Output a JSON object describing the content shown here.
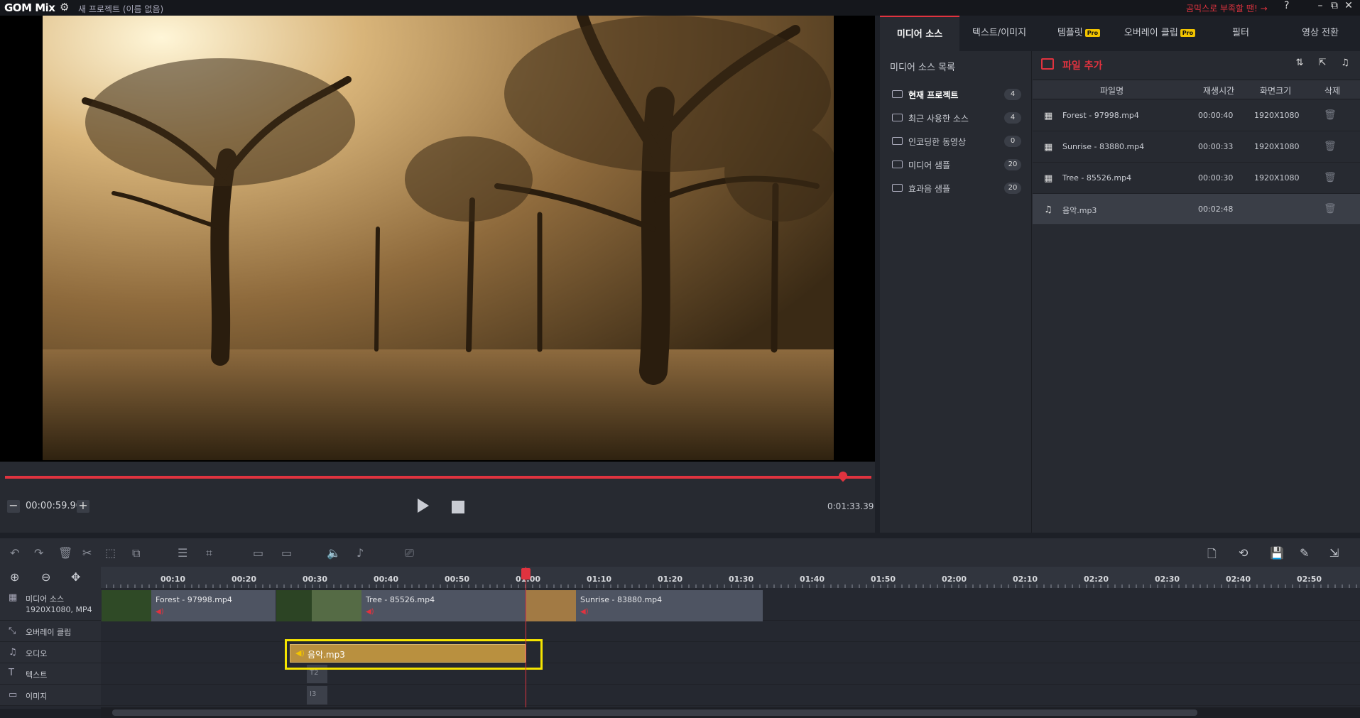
{
  "app": {
    "logo": "GOM Mix",
    "project_title": "새 프로젝트 (이름 없음)",
    "promo": "곰믹스로 부족할 땐! →",
    "help": "?",
    "win_min": "–",
    "win_max": "⧉",
    "win_close": "✕"
  },
  "player": {
    "current_time": "00:00:59.90",
    "total_time": "0:01:33.39",
    "minus": "−",
    "plus": "+"
  },
  "tabs": [
    {
      "label": "미디어 소스",
      "pro": false,
      "active": true
    },
    {
      "label": "텍스트/이미지",
      "pro": false,
      "active": false
    },
    {
      "label": "템플릿",
      "pro": true,
      "active": false
    },
    {
      "label": "오버레이 클립",
      "pro": true,
      "active": false
    },
    {
      "label": "필터",
      "pro": false,
      "active": false
    },
    {
      "label": "영상 전환",
      "pro": false,
      "active": false
    }
  ],
  "pro_badge": "Pro",
  "source_list": {
    "title": "미디어 소스 목록",
    "items": [
      {
        "label": "현재 프로젝트",
        "count": "4"
      },
      {
        "label": "최근 사용한 소스",
        "count": "4"
      },
      {
        "label": "인코딩한 동영상",
        "count": "0"
      },
      {
        "label": "미디어 샘플",
        "count": "20"
      },
      {
        "label": "효과음 샘플",
        "count": "20"
      }
    ]
  },
  "file_panel": {
    "add_file": "파일 추가",
    "columns": [
      "파일명",
      "재생시간",
      "화면크기",
      "삭제"
    ],
    "rows": [
      {
        "icon": "film-icon",
        "name": "Forest - 97998.mp4",
        "duration": "00:00:40",
        "resolution": "1920X1080"
      },
      {
        "icon": "film-icon",
        "name": "Sunrise - 83880.mp4",
        "duration": "00:00:33",
        "resolution": "1920X1080"
      },
      {
        "icon": "film-icon",
        "name": "Tree - 85526.mp4",
        "duration": "00:00:30",
        "resolution": "1920X1080"
      },
      {
        "icon": "music-icon",
        "name": "음악.mp3",
        "duration": "00:02:48",
        "resolution": ""
      }
    ]
  },
  "timeline": {
    "ticks": [
      "00:10",
      "00:20",
      "00:30",
      "00:40",
      "00:50",
      "01:00",
      "01:10",
      "01:20",
      "01:30",
      "01:40",
      "01:50",
      "02:00",
      "02:10",
      "02:20",
      "02:30",
      "02:40",
      "02:50"
    ],
    "tracks": {
      "media_label": "미디어 소스",
      "media_sub": "1920X1080, MP4",
      "overlay_label": "오버레이 클립",
      "audio_label": "오디오",
      "text_label": "텍스트",
      "image_label": "이미지"
    },
    "clips": {
      "forest": "Forest - 97998.mp4",
      "tree": "Tree - 85526.mp4",
      "sunrise": "Sunrise - 83880.mp4"
    },
    "audio_clip": "음악.mp3",
    "text_clip": "T2",
    "image_clip": "I3"
  }
}
